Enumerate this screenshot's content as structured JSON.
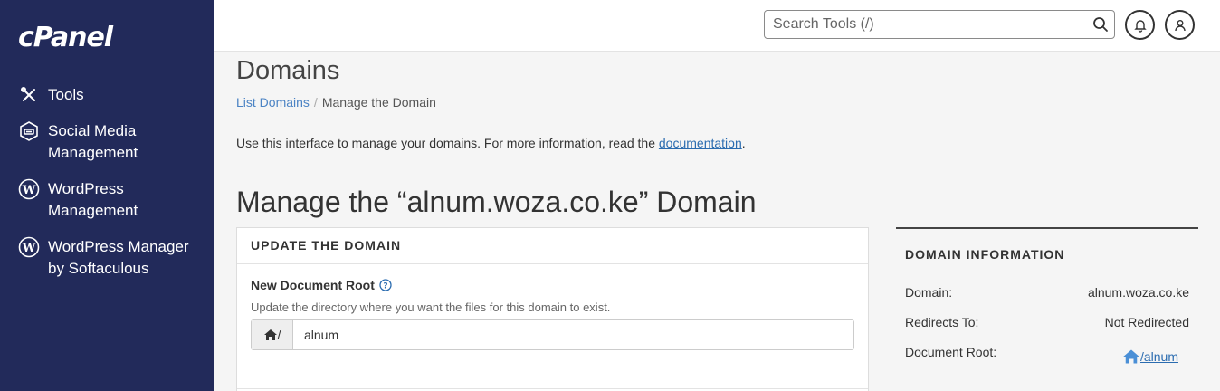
{
  "sidebar": {
    "logo": "cPanel",
    "items": [
      {
        "label": "Tools",
        "icon": "tools-icon"
      },
      {
        "label": "Social Media Management",
        "icon": "social-media-icon"
      },
      {
        "label": "WordPress Management",
        "icon": "wordpress-icon"
      },
      {
        "label": "WordPress Manager by Softaculous",
        "icon": "wordpress-icon"
      }
    ]
  },
  "topbar": {
    "search_placeholder": "Search Tools (/)"
  },
  "main": {
    "title": "Domains",
    "breadcrumb": {
      "link": "List Domains",
      "separator": "/",
      "current": "Manage the Domain"
    },
    "intro_text": "Use this interface to manage your domains. For more information, read the ",
    "intro_link": "documentation",
    "intro_end": ".",
    "domain_title": "Manage the “alnum.woza.co.ke” Domain"
  },
  "update_panel": {
    "title": "UPDATE THE DOMAIN",
    "field_label": "New Document Root",
    "field_help": "Update the directory where you want the files for this domain to exist.",
    "prefix": "/",
    "value": "alnum"
  },
  "info_panel": {
    "title": "DOMAIN INFORMATION",
    "rows": [
      {
        "key": "Domain:",
        "value": "alnum.woza.co.ke"
      },
      {
        "key": "Redirects To:",
        "value": "Not Redirected"
      },
      {
        "key": "Document Root:",
        "value": "/alnum"
      }
    ]
  },
  "colors": {
    "sidebar_bg": "#222a5a",
    "link": "#2b6cb0",
    "link_icon": "#4a8fd6"
  }
}
